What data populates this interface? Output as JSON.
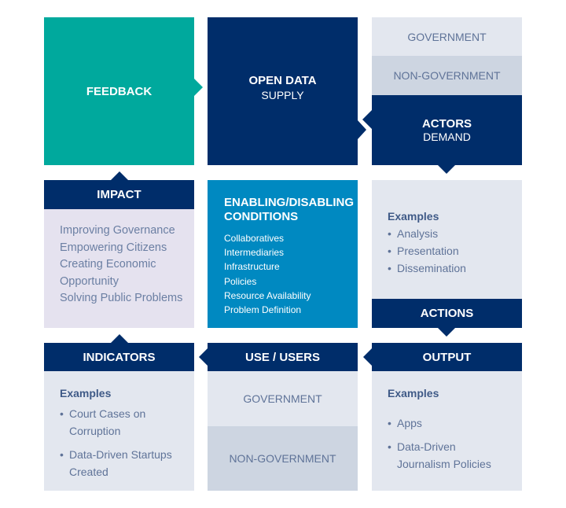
{
  "feedback": "FEEDBACK",
  "open_data": {
    "title": "OPEN DATA",
    "sub": "SUPPLY"
  },
  "actors": {
    "government": "GOVERNMENT",
    "non_government": "NON-GOVERNMENT",
    "title": "ACTORS",
    "sub": "DEMAND"
  },
  "impact": {
    "title": "IMPACT",
    "items": [
      "Improving Governance",
      "Empowering Citizens",
      "Creating Economic Opportunity",
      "Solving Public Problems"
    ]
  },
  "conditions": {
    "title": "ENABLING/DISABLING CONDITIONS",
    "items": [
      "Collaboratives",
      "Intermediaries",
      "Infrastructure",
      "Policies",
      "Resource Availability",
      "Problem Definition"
    ]
  },
  "actions": {
    "examples": "Examples",
    "items": [
      "Analysis",
      "Presentation",
      "Dissemination"
    ],
    "title": "ACTIONS"
  },
  "indicators": {
    "title": "INDICATORS",
    "examples": "Examples",
    "items": [
      "Court Cases on Corruption",
      "Data-Driven Startups Created"
    ]
  },
  "use": {
    "title": "USE / USERS",
    "government": "GOVERNMENT",
    "non_government": "NON-GOVERNMENT"
  },
  "output": {
    "title": "OUTPUT",
    "examples": "Examples",
    "items": [
      "Apps",
      "Data-Driven Journalism Policies"
    ]
  },
  "colors": {
    "navy": "#002d6a",
    "teal": "#00a99d",
    "blue": "#0089c1",
    "lavender": "#e5e2ef",
    "light_gray": "#e3e7ef",
    "gray": "#cdd5e1"
  }
}
